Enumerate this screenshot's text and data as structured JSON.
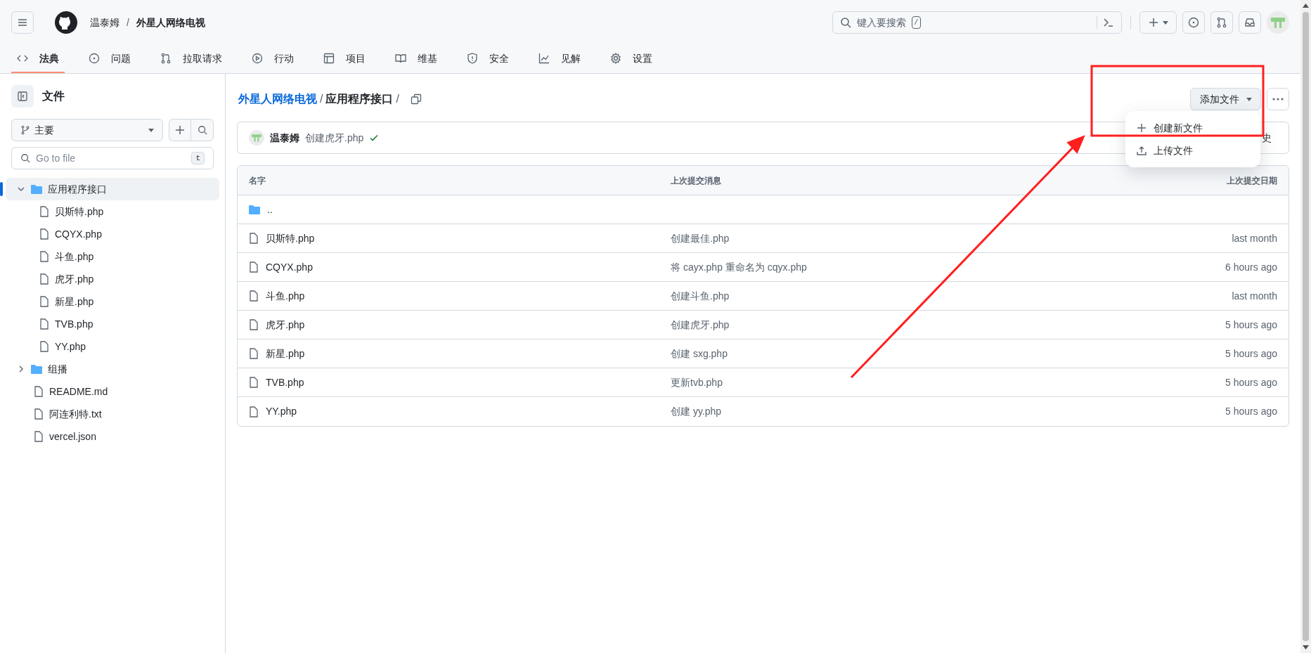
{
  "header": {
    "owner": "温泰姆",
    "separator": "/",
    "repo": "外星人网络电视",
    "search": {
      "placeholder": "键入要搜索",
      "shortcut": "/"
    }
  },
  "nav_tabs": [
    {
      "label": "法典",
      "selected": true
    },
    {
      "label": "问题",
      "selected": false
    },
    {
      "label": "拉取请求",
      "selected": false
    },
    {
      "label": "行动",
      "selected": false
    },
    {
      "label": "项目",
      "selected": false
    },
    {
      "label": "维基",
      "selected": false
    },
    {
      "label": "安全",
      "selected": false
    },
    {
      "label": "见解",
      "selected": false
    },
    {
      "label": "设置",
      "selected": false
    }
  ],
  "sidebar": {
    "title": "文件",
    "branch": "主要",
    "go_to_file": {
      "placeholder": "Go to file",
      "shortcut": "t"
    },
    "tree": [
      {
        "kind": "folder",
        "name": "应用程序接口",
        "expanded": true,
        "selected": true,
        "children": [
          {
            "kind": "file",
            "name": "贝斯特.php"
          },
          {
            "kind": "file",
            "name": "CQYX.php"
          },
          {
            "kind": "file",
            "name": "斗鱼.php"
          },
          {
            "kind": "file",
            "name": "虎牙.php"
          },
          {
            "kind": "file",
            "name": "新星.php"
          },
          {
            "kind": "file",
            "name": "TVB.php"
          },
          {
            "kind": "file",
            "name": "YY.php"
          }
        ]
      },
      {
        "kind": "folder",
        "name": "组播",
        "expanded": false,
        "selected": false
      },
      {
        "kind": "file",
        "name": "README.md"
      },
      {
        "kind": "file",
        "name": "阿连利特.txt"
      },
      {
        "kind": "file",
        "name": "vercel.json"
      }
    ]
  },
  "breadcrumb": {
    "repo_link": "外星人网络电视",
    "folder": "应用程序接口",
    "separator": "/"
  },
  "add_file_button": "添加文件",
  "add_file_menu": [
    {
      "kind": "plus",
      "label": "创建新文件"
    },
    {
      "kind": "upload",
      "label": "上传文件"
    }
  ],
  "latest_commit": {
    "author": "温泰姆",
    "message": "创建虎牙.php",
    "passed": true,
    "history_fragment": "史"
  },
  "table": {
    "columns": [
      "名字",
      "上次提交消息",
      "上次提交日期"
    ],
    "rows": [
      {
        "kind": "parent",
        "name": ".."
      },
      {
        "kind": "file",
        "name": "贝斯特.php",
        "message": "创建最佳.php",
        "date": "last month"
      },
      {
        "kind": "file",
        "name": "CQYX.php",
        "message": "将 cayx.php 重命名为 cqyx.php",
        "date": "6 hours ago"
      },
      {
        "kind": "file",
        "name": "斗鱼.php",
        "message": "创建斗鱼.php",
        "date": "last month"
      },
      {
        "kind": "file",
        "name": "虎牙.php",
        "message": "创建虎牙.php",
        "date": "5 hours ago"
      },
      {
        "kind": "file",
        "name": "新星.php",
        "message": "创建 sxg.php",
        "date": "5 hours ago"
      },
      {
        "kind": "file",
        "name": "TVB.php",
        "message": "更新tvb.php",
        "date": "5 hours ago"
      },
      {
        "kind": "file",
        "name": "YY.php",
        "message": "创建 yy.php",
        "date": "5 hours ago"
      }
    ]
  }
}
